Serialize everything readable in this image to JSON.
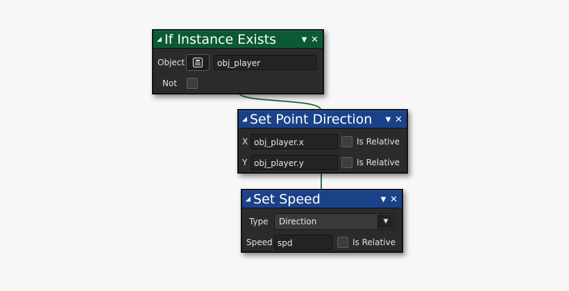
{
  "colors": {
    "canvas_bg": "#f7f7f7",
    "node_body": "#2b2b2b",
    "header_green": "#0c5a34",
    "header_blue": "#1a4289",
    "connector": "#346b47"
  },
  "icons": {
    "collapse": "triangle-collapse-icon",
    "menu": "chevron-down-icon",
    "close": "close-icon",
    "object_picker": "object-icon"
  },
  "nodes": {
    "if_instance_exists": {
      "title": "If Instance Exists",
      "object_label": "Object",
      "object_value": "obj_player",
      "not_label": "Not"
    },
    "set_point_direction": {
      "title": "Set Point Direction",
      "x_label": "X",
      "x_value": "obj_player.x",
      "x_relative_label": "Is Relative",
      "y_label": "Y",
      "y_value": "obj_player.y",
      "y_relative_label": "Is Relative"
    },
    "set_speed": {
      "title": "Set Speed",
      "type_label": "Type",
      "type_value": "Direction",
      "speed_label": "Speed",
      "speed_value": "spd",
      "speed_relative_label": "Is Relative"
    }
  }
}
